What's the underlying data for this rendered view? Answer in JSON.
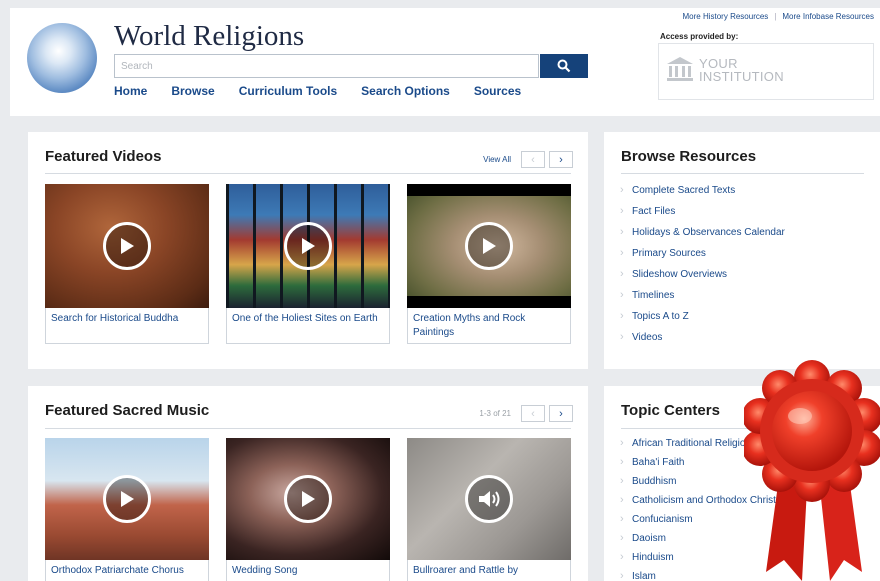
{
  "header": {
    "title": "World Religions",
    "search_placeholder": "Search",
    "nav": [
      "Home",
      "Browse",
      "Curriculum Tools",
      "Search Options",
      "Sources"
    ],
    "top_links": [
      "More History Resources",
      "More Infobase Resources"
    ],
    "access_label": "Access provided by:",
    "institution_line1": "YOUR",
    "institution_line2": "INSTITUTION"
  },
  "featured_videos": {
    "title": "Featured Videos",
    "view_all": "View All",
    "prev": "‹",
    "next": "›",
    "items": [
      {
        "caption": "Search for Historical Buddha"
      },
      {
        "caption": "One of the Holiest Sites on Earth"
      },
      {
        "caption": "Creation Myths and Rock Paintings"
      }
    ]
  },
  "featured_music": {
    "title": "Featured Sacred Music",
    "count": "1-3 of 21",
    "prev": "‹",
    "next": "›",
    "items": [
      {
        "caption": "Orthodox Patriarchate Chorus"
      },
      {
        "caption": "Wedding Song"
      },
      {
        "caption": "Bullroarer and Rattle by"
      }
    ]
  },
  "browse": {
    "title": "Browse Resources",
    "items": [
      "Complete Sacred Texts",
      "Fact Files",
      "Holidays & Observances Calendar",
      "Primary Sources",
      "Slideshow Overviews",
      "Timelines",
      "Topics A to Z",
      "Videos"
    ]
  },
  "topics": {
    "title": "Topic Centers",
    "items": [
      "African Traditional Religions",
      "Baha'i Faith",
      "Buddhism",
      "Catholicism and Orthodox Christianity",
      "Confucianism",
      "Daoism",
      "Hinduism",
      "Islam"
    ]
  },
  "colors": {
    "brand_blue": "#15427a",
    "link_blue": "#1a4a8a",
    "ribbon_red": "#e0241a",
    "page_bg": "#e9ebee"
  },
  "icons": {
    "search": "search-icon",
    "play": "play-icon",
    "audio": "speaker-icon",
    "institution": "building-icon",
    "award": "award-ribbon"
  }
}
